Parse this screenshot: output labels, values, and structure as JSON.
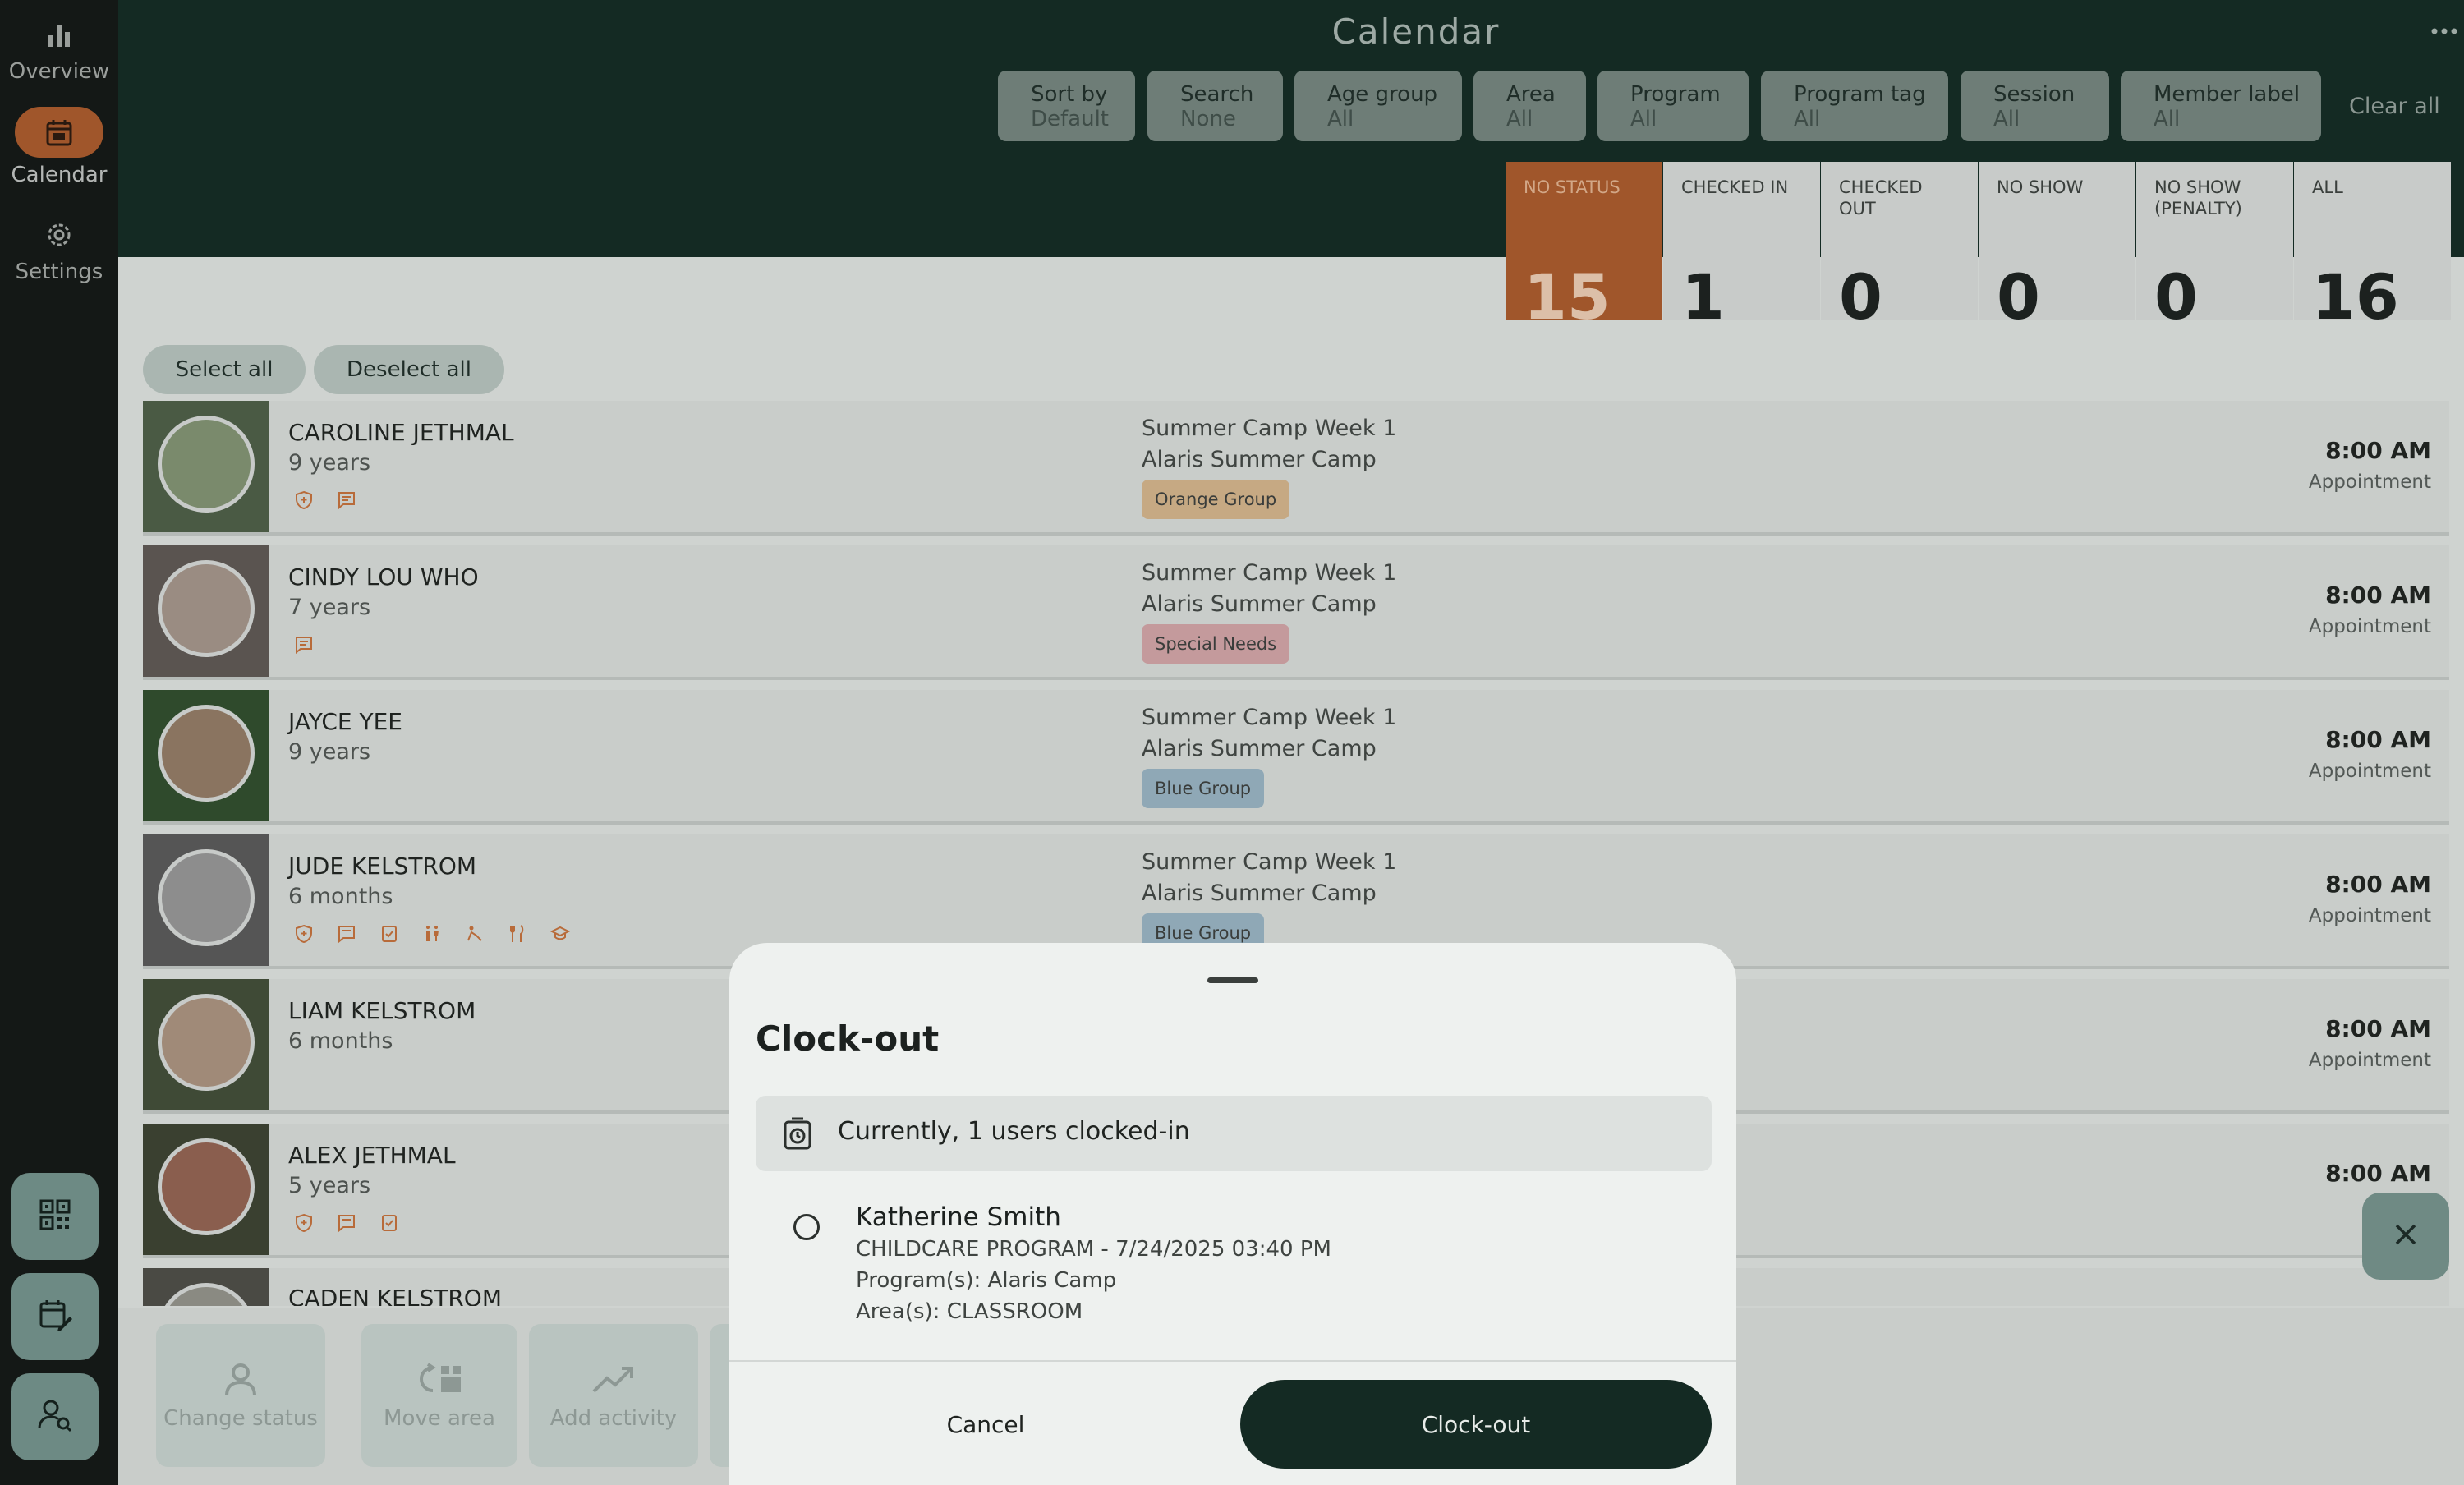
{
  "header": {
    "title": "Calendar",
    "clear_all": "Clear all"
  },
  "sidebar": {
    "items": [
      {
        "label": "Overview",
        "icon": "bar-chart-icon"
      },
      {
        "label": "Calendar",
        "icon": "calendar-icon",
        "active": true
      },
      {
        "label": "Settings",
        "icon": "gear-icon"
      }
    ]
  },
  "filters": [
    {
      "label": "Sort by",
      "value": "Default"
    },
    {
      "label": "Search",
      "value": "None"
    },
    {
      "label": "Age group",
      "value": "All"
    },
    {
      "label": "Area",
      "value": "All"
    },
    {
      "label": "Program",
      "value": "All"
    },
    {
      "label": "Program tag",
      "value": "All"
    },
    {
      "label": "Session",
      "value": "All"
    },
    {
      "label": "Member label",
      "value": "All"
    }
  ],
  "stats": [
    {
      "label": "NO STATUS",
      "count": "15"
    },
    {
      "label": "CHECKED IN",
      "count": "1"
    },
    {
      "label": "CHECKED OUT",
      "count": "0"
    },
    {
      "label": "NO SHOW",
      "count": "0"
    },
    {
      "label": "NO SHOW (PENALTY)",
      "count": "0"
    },
    {
      "label": "ALL",
      "count": "16"
    }
  ],
  "selection": {
    "select_all": "Select all",
    "deselect_all": "Deselect all"
  },
  "rows": [
    {
      "name": "CAROLINE JETHMAL",
      "age": "9 years",
      "program_line1": "Summer Camp Week 1",
      "program_line2": "Alaris Summer Camp",
      "tag": "Orange Group",
      "time": "8:00 AM",
      "type": "Appointment"
    },
    {
      "name": "CINDY LOU WHO",
      "age": "7 years",
      "program_line1": "Summer Camp Week 1",
      "program_line2": "Alaris Summer Camp",
      "tag": "Special Needs",
      "time": "8:00 AM",
      "type": "Appointment"
    },
    {
      "name": "JAYCE YEE",
      "age": "9 years",
      "program_line1": "Summer Camp Week 1",
      "program_line2": "Alaris Summer Camp",
      "tag": "Blue Group",
      "time": "8:00 AM",
      "type": "Appointment"
    },
    {
      "name": "JUDE KELSTROM",
      "age": "6 months",
      "program_line1": "Summer Camp Week 1",
      "program_line2": "Alaris Summer Camp",
      "tag": "Blue Group",
      "time": "8:00 AM",
      "type": "Appointment"
    },
    {
      "name": "LIAM KELSTROM",
      "age": "6 months",
      "time": "8:00 AM",
      "type": "Appointment"
    },
    {
      "name": "ALEX JETHMAL",
      "age": "5 years",
      "time": "8:00 AM",
      "type": "Appoi"
    },
    {
      "name": "CADEN KELSTROM"
    }
  ],
  "actions": {
    "change_status": "Change status",
    "move_area": "Move area",
    "add_activity": "Add activity"
  },
  "sheet": {
    "title": "Clock-out",
    "info": "Currently, 1 users clocked-in",
    "user": {
      "name": "Katherine Smith",
      "line1": "CHILDCARE PROGRAM  - 7/24/2025 03:40 PM",
      "line2": "Program(s): Alaris Camp",
      "line3": "Area(s): CLASSROOM"
    },
    "cancel": "Cancel",
    "confirm": "Clock-out"
  },
  "colors": {
    "header_bg": "#142a23",
    "accent": "#a0562b",
    "sidebar_bg": "#141816",
    "tag_orange": "#c6a983",
    "tag_pink": "#c49a9c",
    "tag_blue": "#8fa8b6"
  }
}
